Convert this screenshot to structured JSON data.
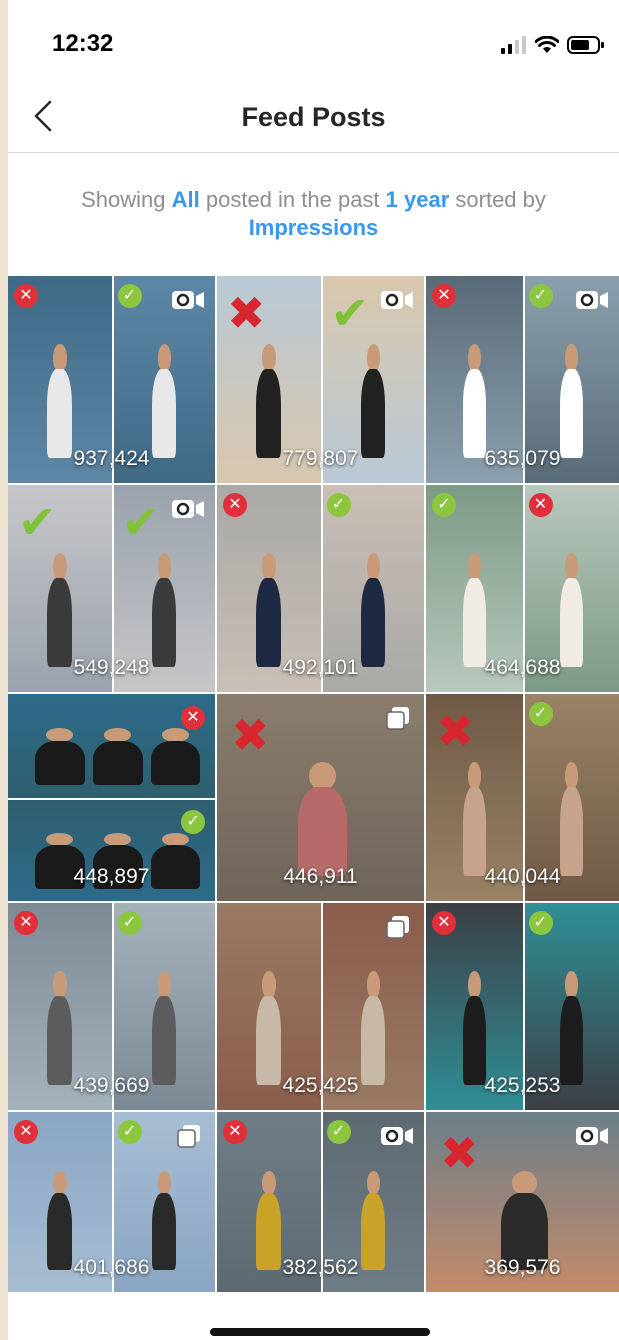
{
  "status_bar": {
    "time": "12:32",
    "icons": [
      "signal-icon",
      "wifi-icon",
      "battery-icon"
    ]
  },
  "nav": {
    "title": "Feed Posts",
    "back_icon": "chevron-left-icon"
  },
  "summary": {
    "prefix": "Showing ",
    "filter": "All",
    "middle": " posted in the past ",
    "period": "1 year",
    "suffix": " sorted by ",
    "sort": "Impressions"
  },
  "colors": {
    "accent": "#3897f0",
    "reject": "#e0303a",
    "approve": "#8cc63f"
  },
  "posts": [
    {
      "impressions": "937,424",
      "type": "video",
      "layout": "split",
      "marks": [
        "reject-badge",
        "approve-badge"
      ]
    },
    {
      "impressions": "779,807",
      "type": "video",
      "layout": "split",
      "marks": [
        "reject-cross",
        "approve-tick"
      ]
    },
    {
      "impressions": "635,079",
      "type": "video",
      "layout": "split",
      "marks": [
        "reject-badge",
        "approve-badge"
      ]
    },
    {
      "impressions": "549,248",
      "type": "video",
      "layout": "split",
      "marks": [
        "approve-tick",
        "approve-tick"
      ]
    },
    {
      "impressions": "492,101",
      "type": "image",
      "layout": "split",
      "marks": [
        "reject-badge",
        "approve-badge"
      ]
    },
    {
      "impressions": "464,688",
      "type": "image",
      "layout": "split",
      "marks": [
        "approve-badge",
        "reject-badge"
      ]
    },
    {
      "impressions": "448,897",
      "type": "image",
      "layout": "stacked",
      "marks": [
        "reject-badge",
        "approve-badge"
      ]
    },
    {
      "impressions": "446,911",
      "type": "carousel",
      "layout": "single",
      "marks": [
        "reject-cross"
      ]
    },
    {
      "impressions": "440,044",
      "type": "image",
      "layout": "split",
      "marks": [
        "reject-cross",
        "approve-badge"
      ]
    },
    {
      "impressions": "439,669",
      "type": "image",
      "layout": "split",
      "marks": [
        "reject-badge",
        "approve-badge"
      ]
    },
    {
      "impressions": "425,425",
      "type": "carousel",
      "layout": "split",
      "marks": []
    },
    {
      "impressions": "425,253",
      "type": "image",
      "layout": "split",
      "marks": [
        "reject-badge",
        "approve-badge"
      ]
    },
    {
      "impressions": "401,686",
      "type": "carousel",
      "layout": "split",
      "marks": [
        "reject-badge",
        "approve-badge"
      ]
    },
    {
      "impressions": "382,562",
      "type": "video",
      "layout": "split",
      "marks": [
        "reject-badge",
        "approve-badge"
      ]
    },
    {
      "impressions": "369,576",
      "type": "video",
      "layout": "single",
      "marks": [
        "reject-cross"
      ]
    }
  ]
}
